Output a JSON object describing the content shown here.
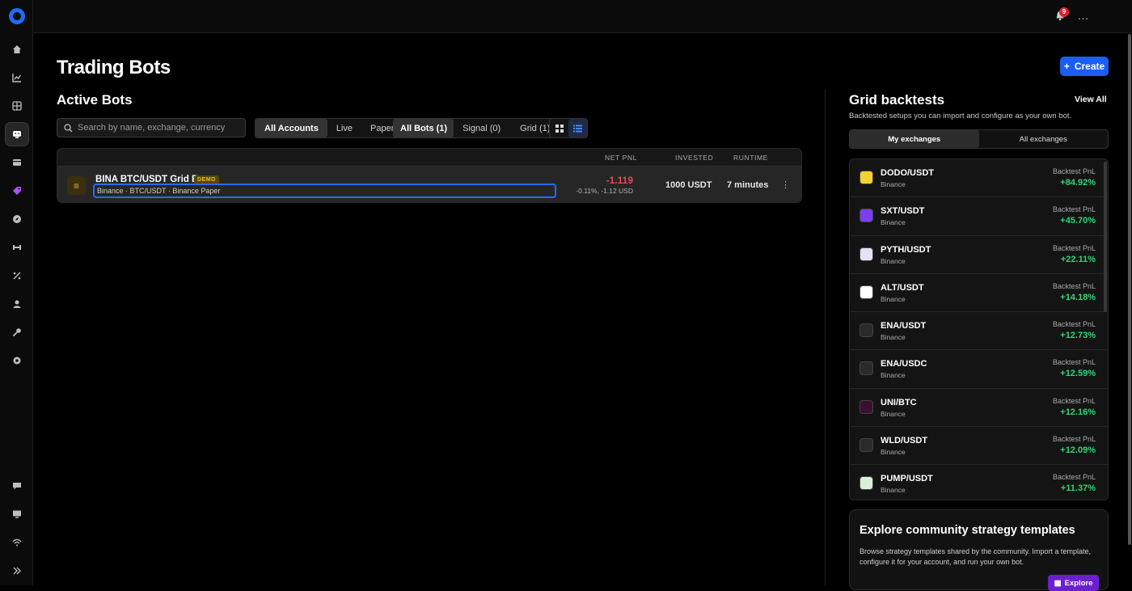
{
  "topbar": {
    "notification_count": "9",
    "more_label": "..."
  },
  "page": {
    "title": "Trading Bots",
    "create_label": "Create"
  },
  "active_bots": {
    "title": "Active Bots",
    "search_placeholder": "Search by name, exchange, currency",
    "account_filters": [
      "All Accounts",
      "Live",
      "Paper"
    ],
    "bot_filters": [
      "All Bots (1)",
      "Signal (0)",
      "Grid (1)"
    ],
    "columns": {
      "net_pnl": "NET PNL",
      "invested": "INVESTED",
      "runtime": "RUNTIME"
    },
    "bot": {
      "name": "BINA BTC/USDT Grid Bot",
      "badge": "DEMO",
      "subtitle": "Binance · BTC/USDT · Binance Paper",
      "pnl": "-1.119",
      "pnl_detail": "-0.11%, -1.12 USD",
      "invested": "1000 USDT",
      "runtime": "7 minutes"
    }
  },
  "grid_backtests": {
    "title": "Grid backtests",
    "subtitle": "Backtested setups you can import and configure as your own bot.",
    "view_all": "View All",
    "tabs": [
      "My exchanges",
      "All exchanges"
    ],
    "pnl_label": "Backtest PnL",
    "items": [
      {
        "pair": "DODO/USDT",
        "exchange": "Binance",
        "pnl": "+84.92%",
        "icon_color": "#f2d230",
        "icon_name": "dodo-icon"
      },
      {
        "pair": "SXT/USDT",
        "exchange": "Binance",
        "pnl": "+45.70%",
        "icon_color": "#7b3ef0",
        "icon_name": "sxt-icon"
      },
      {
        "pair": "PYTH/USDT",
        "exchange": "Binance",
        "pnl": "+22.11%",
        "icon_color": "#e8e0f5",
        "icon_name": "pyth-icon"
      },
      {
        "pair": "ALT/USDT",
        "exchange": "Binance",
        "pnl": "+14.18%",
        "icon_color": "#ffffff",
        "icon_name": "alt-icon"
      },
      {
        "pair": "ENA/USDT",
        "exchange": "Binance",
        "pnl": "+12.73%",
        "icon_color": "#2a2a2a",
        "icon_name": "ena-icon"
      },
      {
        "pair": "ENA/USDC",
        "exchange": "Binance",
        "pnl": "+12.59%",
        "icon_color": "#2a2a2a",
        "icon_name": "ena-icon"
      },
      {
        "pair": "UNI/BTC",
        "exchange": "Binance",
        "pnl": "+12.16%",
        "icon_color": "#3a1030",
        "icon_name": "uni-icon"
      },
      {
        "pair": "WLD/USDT",
        "exchange": "Binance",
        "pnl": "+12.09%",
        "icon_color": "#2a2a2a",
        "icon_name": "wld-icon"
      },
      {
        "pair": "PUMP/USDT",
        "exchange": "Binance",
        "pnl": "+11.37%",
        "icon_color": "#d8f0d8",
        "icon_name": "pump-icon"
      }
    ]
  },
  "explore": {
    "title": "Explore community strategy templates",
    "description": "Browse strategy templates shared by the community. Import a template, configure it for your account, and run your own bot.",
    "button": "Explore"
  },
  "colors": {
    "accent": "#1c5ef2",
    "negative": "#f0465a",
    "positive": "#2fd67a",
    "demo": "#f2b93a",
    "explore": "#6b1fd1"
  }
}
